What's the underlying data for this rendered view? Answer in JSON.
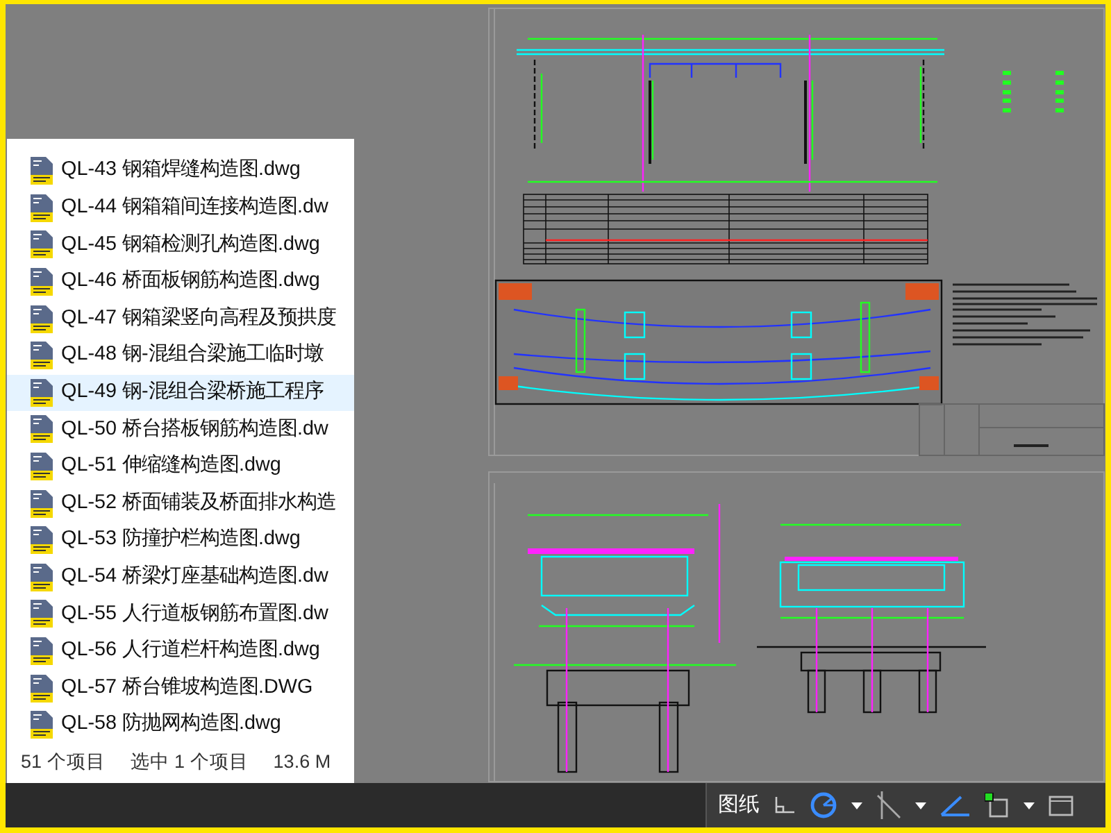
{
  "files": [
    {
      "name": "QL-43 钢箱焊缝构造图.dwg",
      "selected": false
    },
    {
      "name": "QL-44 钢箱箱间连接构造图.dw",
      "selected": false
    },
    {
      "name": "QL-45 钢箱检测孔构造图.dwg",
      "selected": false
    },
    {
      "name": "QL-46 桥面板钢筋构造图.dwg",
      "selected": false
    },
    {
      "name": "QL-47 钢箱梁竖向高程及预拱度",
      "selected": false
    },
    {
      "name": "QL-48 钢-混组合梁施工临时墩",
      "selected": false
    },
    {
      "name": "QL-49 钢-混组合梁桥施工程序",
      "selected": true
    },
    {
      "name": "QL-50 桥台搭板钢筋构造图.dw",
      "selected": false
    },
    {
      "name": "QL-51 伸缩缝构造图.dwg",
      "selected": false
    },
    {
      "name": "QL-52 桥面铺装及桥面排水构造",
      "selected": false
    },
    {
      "name": "QL-53 防撞护栏构造图.dwg",
      "selected": false
    },
    {
      "name": "QL-54 桥梁灯座基础构造图.dw",
      "selected": false
    },
    {
      "name": "QL-55 人行道板钢筋布置图.dw",
      "selected": false
    },
    {
      "name": "QL-56 人行道栏杆构造图.dwg",
      "selected": false
    },
    {
      "name": "QL-57 桥台锥坡构造图.DWG",
      "selected": false
    },
    {
      "name": "QL-58 防抛网构造图.dwg",
      "selected": false
    }
  ],
  "status": {
    "count": "51 个项目",
    "selection": "选中 1 个项目",
    "size": "13.6 M"
  },
  "toolbar": {
    "label": "图纸"
  }
}
